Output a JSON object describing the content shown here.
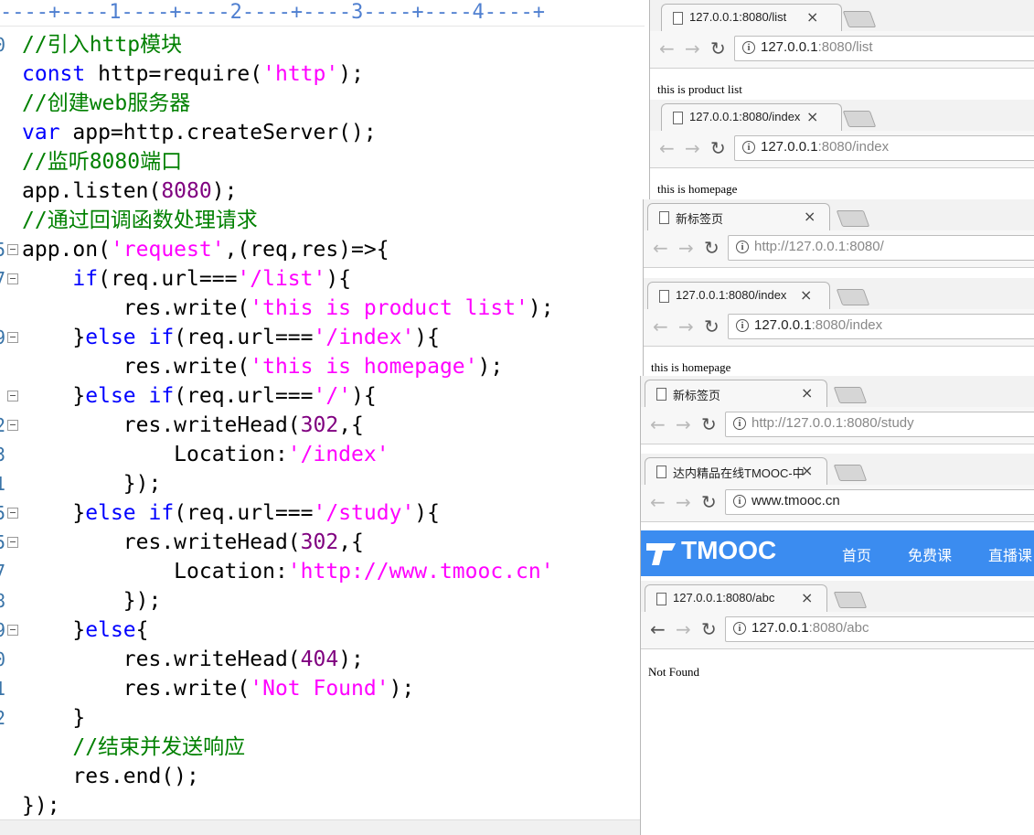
{
  "editor": {
    "ruler": "----+----1----+----2----+----3----+----4----+",
    "line_numbers": [
      "0",
      "",
      "",
      "",
      "",
      "",
      "",
      "5",
      "7",
      "",
      "9",
      "",
      "",
      "2",
      "3",
      "1",
      "5",
      "5",
      "7",
      "8",
      "9",
      "0",
      "1",
      "2",
      "",
      "",
      ""
    ],
    "lines": [
      [
        {
          "c": "cm",
          "t": "//引入http模块"
        }
      ],
      [
        {
          "c": "kw",
          "t": "const"
        },
        {
          "c": "",
          "t": " http=require("
        },
        {
          "c": "str",
          "t": "'http'"
        },
        {
          "c": "",
          "t": ");"
        }
      ],
      [
        {
          "c": "cm",
          "t": "//创建web服务器"
        }
      ],
      [
        {
          "c": "kw",
          "t": "var"
        },
        {
          "c": "",
          "t": " app=http.createServer();"
        }
      ],
      [
        {
          "c": "cm",
          "t": "//监听8080端口"
        }
      ],
      [
        {
          "c": "",
          "t": "app.listen("
        },
        {
          "c": "num",
          "t": "8080"
        },
        {
          "c": "",
          "t": ");"
        }
      ],
      [
        {
          "c": "cm",
          "t": "//通过回调函数处理请求"
        }
      ],
      [
        {
          "c": "",
          "t": "app.on("
        },
        {
          "c": "str",
          "t": "'request'"
        },
        {
          "c": "",
          "t": ",(req,res)=>{"
        }
      ],
      [
        {
          "c": "",
          "t": "    "
        },
        {
          "c": "kw",
          "t": "if"
        },
        {
          "c": "",
          "t": "(req.url==="
        },
        {
          "c": "str",
          "t": "'/list'"
        },
        {
          "c": "",
          "t": "){"
        }
      ],
      [
        {
          "c": "",
          "t": "        res.write("
        },
        {
          "c": "str",
          "t": "'this is product list'"
        },
        {
          "c": "",
          "t": ");"
        }
      ],
      [
        {
          "c": "",
          "t": "    }"
        },
        {
          "c": "kw",
          "t": "else if"
        },
        {
          "c": "",
          "t": "(req.url==="
        },
        {
          "c": "str",
          "t": "'/index'"
        },
        {
          "c": "",
          "t": "){"
        }
      ],
      [
        {
          "c": "",
          "t": "        res.write("
        },
        {
          "c": "str",
          "t": "'this is homepage'"
        },
        {
          "c": "",
          "t": ");"
        }
      ],
      [
        {
          "c": "",
          "t": "    }"
        },
        {
          "c": "kw",
          "t": "else if"
        },
        {
          "c": "",
          "t": "(req.url==="
        },
        {
          "c": "str",
          "t": "'/'"
        },
        {
          "c": "",
          "t": "){"
        }
      ],
      [
        {
          "c": "",
          "t": "        res.writeHead("
        },
        {
          "c": "num",
          "t": "302"
        },
        {
          "c": "",
          "t": ",{"
        }
      ],
      [
        {
          "c": "",
          "t": "            Location:"
        },
        {
          "c": "str",
          "t": "'/index'"
        }
      ],
      [
        {
          "c": "",
          "t": "        });"
        }
      ],
      [
        {
          "c": "",
          "t": "    }"
        },
        {
          "c": "kw",
          "t": "else if"
        },
        {
          "c": "",
          "t": "(req.url==="
        },
        {
          "c": "str",
          "t": "'/study'"
        },
        {
          "c": "",
          "t": "){"
        }
      ],
      [
        {
          "c": "",
          "t": "        res.writeHead("
        },
        {
          "c": "num",
          "t": "302"
        },
        {
          "c": "",
          "t": ",{"
        }
      ],
      [
        {
          "c": "",
          "t": "            Location:"
        },
        {
          "c": "str",
          "t": "'http://www.tmooc.cn'"
        }
      ],
      [
        {
          "c": "",
          "t": "        });"
        }
      ],
      [
        {
          "c": "",
          "t": "    }"
        },
        {
          "c": "kw",
          "t": "else"
        },
        {
          "c": "",
          "t": "{"
        }
      ],
      [
        {
          "c": "",
          "t": "        res.writeHead("
        },
        {
          "c": "num",
          "t": "404"
        },
        {
          "c": "",
          "t": ");"
        }
      ],
      [
        {
          "c": "",
          "t": "        res.write("
        },
        {
          "c": "str",
          "t": "'Not Found'"
        },
        {
          "c": "",
          "t": ");"
        }
      ],
      [
        {
          "c": "",
          "t": "    }"
        }
      ],
      [
        {
          "c": "",
          "t": "    "
        },
        {
          "c": "cm",
          "t": "//结束并发送响应"
        }
      ],
      [
        {
          "c": "",
          "t": "    res.end();"
        }
      ],
      [
        {
          "c": "",
          "t": "});"
        }
      ]
    ]
  },
  "browsers": [
    {
      "tab_title": "127.0.0.1:8080/list",
      "url_host": "127.0.0.1",
      "url_rest": ":8080/list",
      "page_text": "this is product list"
    },
    {
      "tab_title": "127.0.0.1:8080/index",
      "url_host": "127.0.0.1",
      "url_rest": ":8080/index",
      "page_text": "this is homepage"
    },
    {
      "tab_title": "新标签页",
      "url_host": "",
      "url_rest": "http://127.0.0.1:8080/",
      "page_text": ""
    },
    {
      "tab_title": "127.0.0.1:8080/index",
      "url_host": "127.0.0.1",
      "url_rest": ":8080/index",
      "page_text": "this is homepage"
    },
    {
      "tab_title": "新标签页",
      "url_host": "",
      "url_rest": "http://127.0.0.1:8080/study",
      "page_text": ""
    },
    {
      "tab_title": "达内精品在线TMOOC-中",
      "url_host": "www.tmooc.cn",
      "url_rest": "",
      "page_text": "",
      "brand": "TMOOC",
      "nav": [
        "首页",
        "免费课",
        "直播课"
      ]
    },
    {
      "tab_title": "127.0.0.1:8080/abc",
      "url_host": "127.0.0.1",
      "url_rest": ":8080/abc",
      "page_text": "Not Found"
    }
  ],
  "colors": {
    "comment": "#008000",
    "keyword": "#0000ff",
    "string": "#ff00ff",
    "number": "#800080",
    "tmooc_blue": "#3b8cf0"
  }
}
